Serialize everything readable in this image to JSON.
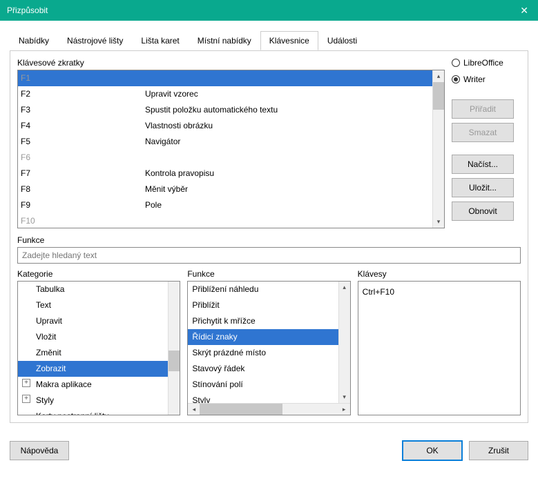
{
  "titlebar": {
    "title": "Přizpůsobit"
  },
  "tabs": [
    "Nabídky",
    "Nástrojové lišty",
    "Lišta karet",
    "Místní nabídky",
    "Klávesnice",
    "Události"
  ],
  "activeTab": 4,
  "labels": {
    "shortcuts": "Klávesové zkratky",
    "functions": "Funkce",
    "category": "Kategorie",
    "function": "Funkce",
    "keys": "Klávesy"
  },
  "search": {
    "placeholder": "Zadejte hledaný text"
  },
  "shortcutRows": [
    {
      "key": "F1",
      "func": "",
      "selected": true,
      "disabled": true
    },
    {
      "key": "F2",
      "func": "Upravit vzorec"
    },
    {
      "key": "F3",
      "func": "Spustit položku automatického textu"
    },
    {
      "key": "F4",
      "func": "Vlastnosti obrázku"
    },
    {
      "key": "F5",
      "func": "Navigátor"
    },
    {
      "key": "F6",
      "func": "",
      "disabled": true
    },
    {
      "key": "F7",
      "func": "Kontrola pravopisu"
    },
    {
      "key": "F8",
      "func": "Měnit výběr"
    },
    {
      "key": "F9",
      "func": "Pole"
    },
    {
      "key": "F10",
      "func": "",
      "disabled": true
    }
  ],
  "scope": {
    "libreoffice": "LibreOffice",
    "writer": "Writer",
    "selected": "writer"
  },
  "buttons": {
    "assign": "Přiřadit",
    "delete": "Smazat",
    "load": "Načíst...",
    "save": "Uložit...",
    "reset": "Obnovit",
    "help": "Nápověda",
    "ok": "OK",
    "cancel": "Zrušit"
  },
  "categories": [
    {
      "label": "Tabulka"
    },
    {
      "label": "Text"
    },
    {
      "label": "Upravit"
    },
    {
      "label": "Vložit"
    },
    {
      "label": "Změnit"
    },
    {
      "label": "Zobrazit",
      "selected": true
    },
    {
      "label": "Makra aplikace",
      "expandable": true
    },
    {
      "label": "Styly",
      "expandable": true
    },
    {
      "label": "Karty postranní lišty"
    }
  ],
  "functions": [
    {
      "label": "Přiblížení náhledu"
    },
    {
      "label": "Přiblížit"
    },
    {
      "label": "Přichytit k mřížce"
    },
    {
      "label": "Řídicí znaky",
      "selected": true
    },
    {
      "label": "Skrýt prázdné místo"
    },
    {
      "label": "Stavový řádek"
    },
    {
      "label": "Stínování polí"
    },
    {
      "label": "Styly"
    }
  ],
  "keys": [
    "Ctrl+F10"
  ]
}
